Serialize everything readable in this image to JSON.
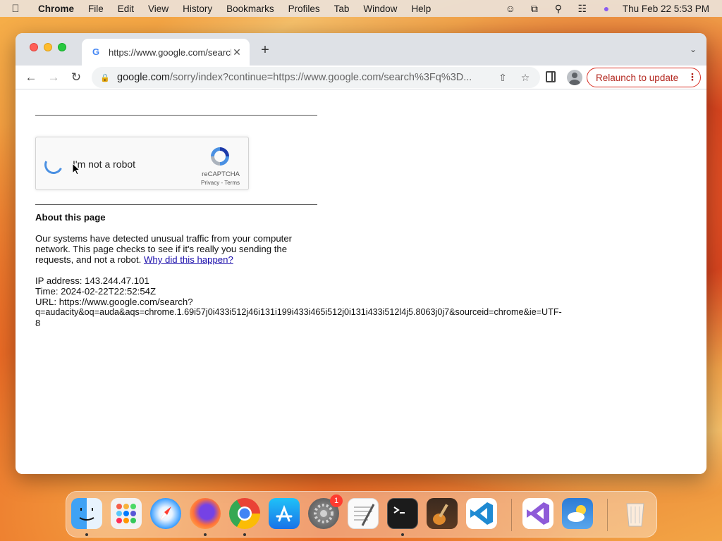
{
  "menubar": {
    "app_name": "Chrome",
    "items": [
      "File",
      "Edit",
      "View",
      "History",
      "Bookmarks",
      "Profiles",
      "Tab",
      "Window",
      "Help"
    ],
    "clock": "Thu Feb 22  5:53 PM"
  },
  "browser": {
    "tab_title": "https://www.google.com/search?q=audacity",
    "url_host": "google.com",
    "url_path": "/sorry/index?continue=https://www.google.com/search%3Fq%3D...",
    "relaunch_label": "Relaunch to update"
  },
  "page": {
    "captcha_label": "I'm not a robot",
    "recaptcha_brand": "reCAPTCHA",
    "recaptcha_links": "Privacy - Terms",
    "about_title": "About this page",
    "about_text": "Our systems have detected unusual traffic from your computer network. This page checks to see if it's really you sending the requests, and not a robot. ",
    "about_link": "Why did this happen?",
    "ip_line": "IP address: 143.244.47.101",
    "time_line": "Time: 2024-02-22T22:52:54Z",
    "url_line1": "URL: https://www.google.com/search?",
    "url_line2": "q=audacity&oq=auda&aqs=chrome.1.69i57j0i433i512j46i131i199i433i465i512j0i131i433i512l4j5.8063j0j7&sourceid=chrome&ie=UTF-",
    "url_line3": "8"
  },
  "dock": {
    "apps": [
      "Finder",
      "Launchpad",
      "Safari",
      "Firefox",
      "Chrome",
      "App Store",
      "System Settings",
      "TextEdit",
      "Terminal",
      "GarageBand",
      "Visual Studio Code",
      "Visual Studio",
      "Weather",
      "Trash"
    ],
    "settings_badge": "1"
  }
}
